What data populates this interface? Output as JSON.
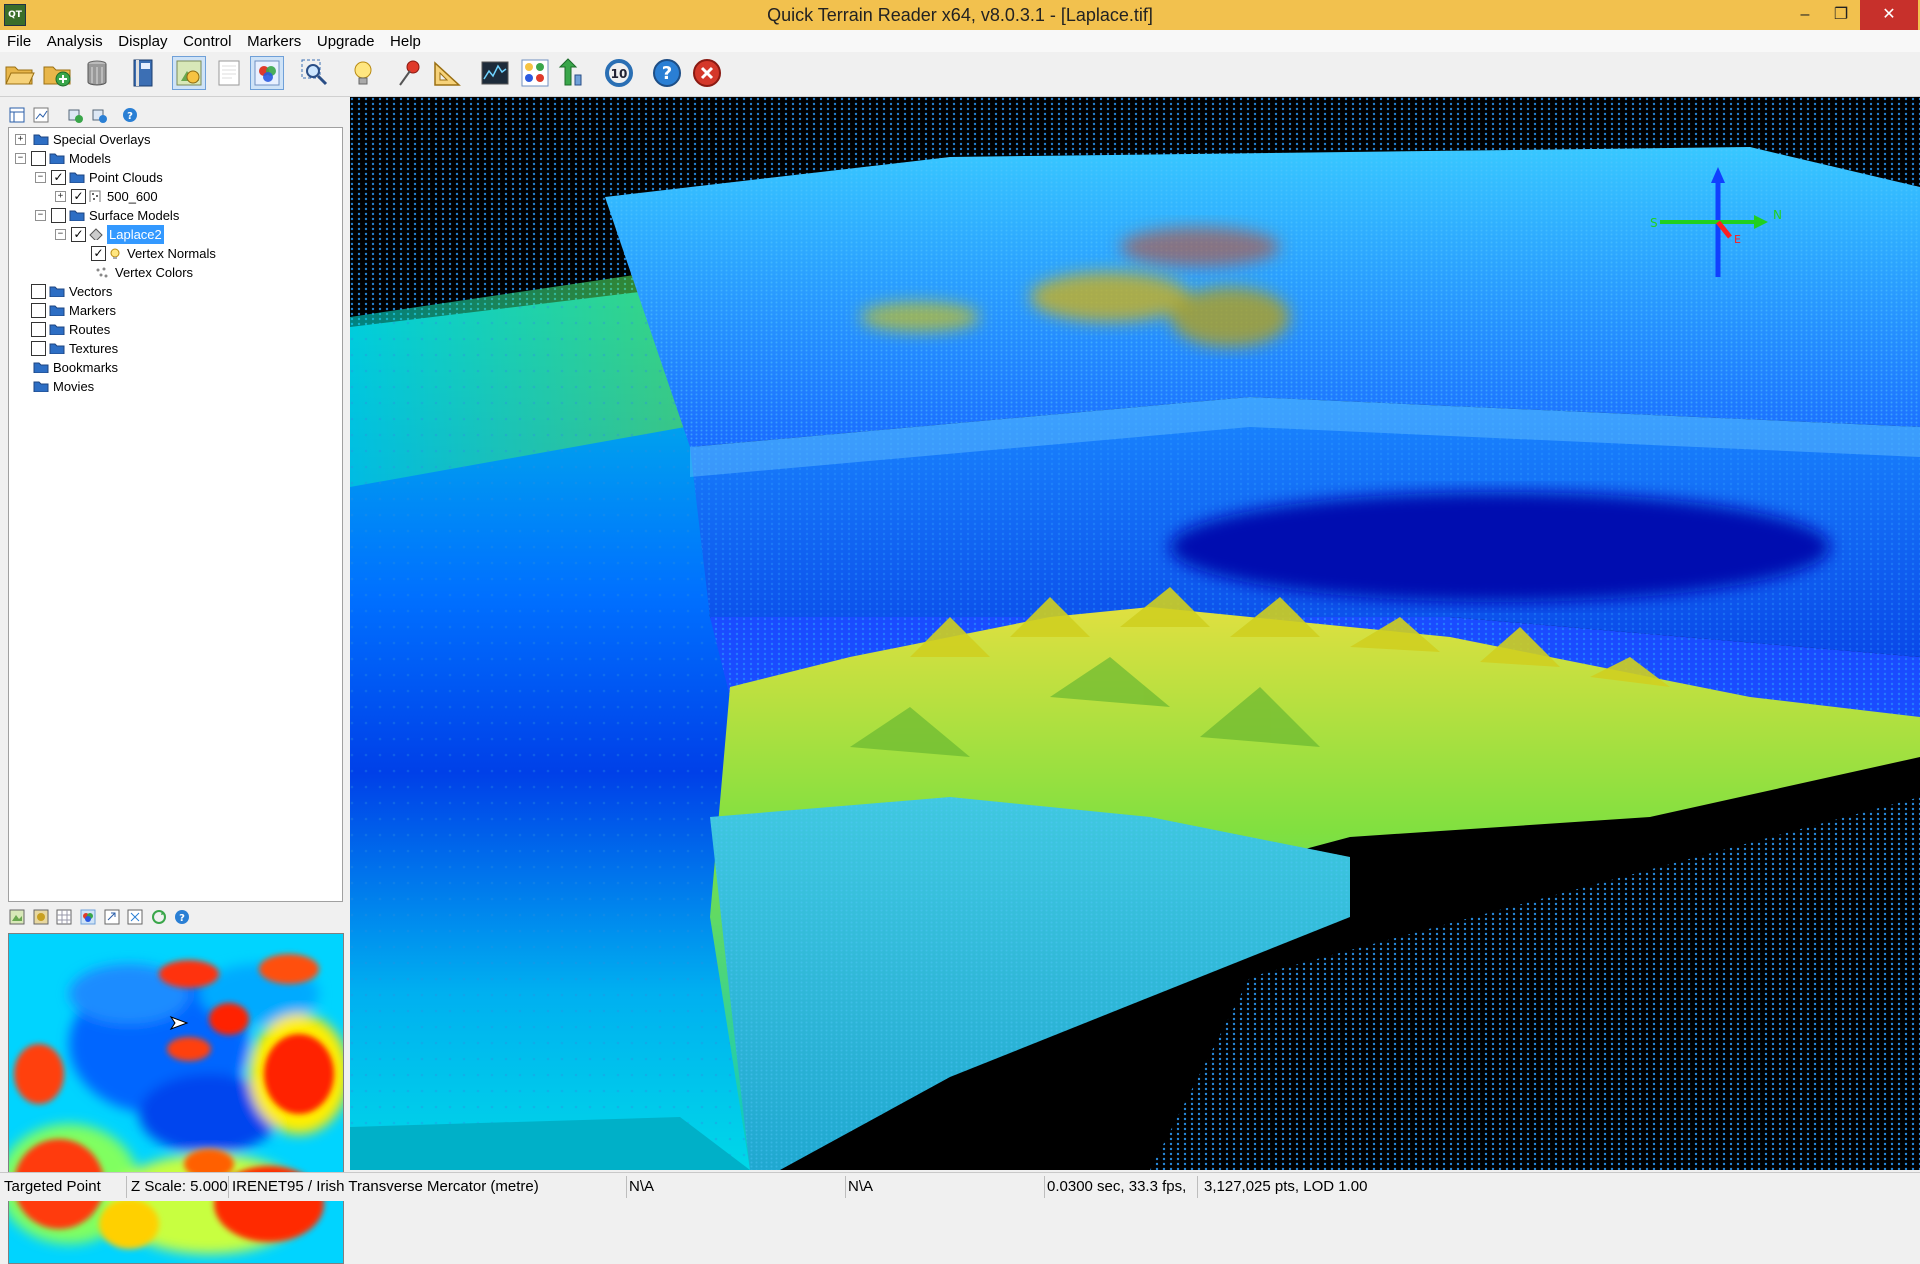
{
  "window": {
    "app_icon": "QT",
    "title": "Quick Terrain Reader x64, v8.0.3.1 - [Laplace.tif]",
    "minimize": "–",
    "maximize": "❐",
    "close": "✕"
  },
  "menu": [
    "File",
    "Analysis",
    "Display",
    "Control",
    "Markers",
    "Upgrade",
    "Help"
  ],
  "toolbar": {
    "icons": [
      "open-folder-icon",
      "add-folder-icon",
      "trash-icon",
      "book-icon",
      "layer-view-icon",
      "blank-page-icon",
      "color-layers-icon",
      "zoom-region-icon",
      "light-bulb-icon",
      "pin-marker-icon",
      "measure-triangle-icon",
      "profile-chart-icon",
      "grid-select-icon",
      "export-arrow-icon",
      "refresh-10-icon",
      "help-icon",
      "close-icon"
    ],
    "refresh_text": "10",
    "help_text": "?"
  },
  "tree": {
    "items": [
      {
        "label": "Special Overlays"
      },
      {
        "label": "Models"
      },
      {
        "label": "Point Clouds"
      },
      {
        "label": "500_600"
      },
      {
        "label": "Surface Models"
      },
      {
        "label": "Laplace2"
      },
      {
        "label": "Vertex Normals"
      },
      {
        "label": "Vertex Colors"
      },
      {
        "label": "Vectors"
      },
      {
        "label": "Markers"
      },
      {
        "label": "Routes"
      },
      {
        "label": "Textures"
      },
      {
        "label": "Bookmarks"
      },
      {
        "label": "Movies"
      }
    ]
  },
  "compass": {
    "north": "N",
    "south": "S",
    "east": "E"
  },
  "status": {
    "mode": "Targeted Point",
    "zscale": "Z Scale: 5.000(",
    "projection": "IRENET95 / Irish Transverse Mercator (metre)",
    "field1": "N\\A",
    "field2": "N\\A",
    "timing": "0.0300 sec,  33.3 fps,",
    "points": "3,127,025 pts, LOD 1.00"
  },
  "colors": {
    "titlebar": "#f2c14e",
    "close": "#c7302b",
    "selection": "#3399ff",
    "terrain_low": "#0000cc",
    "terrain_mid": "#00d4ff",
    "terrain_high": "#c8e000",
    "terrain_peak": "#ff2000"
  }
}
